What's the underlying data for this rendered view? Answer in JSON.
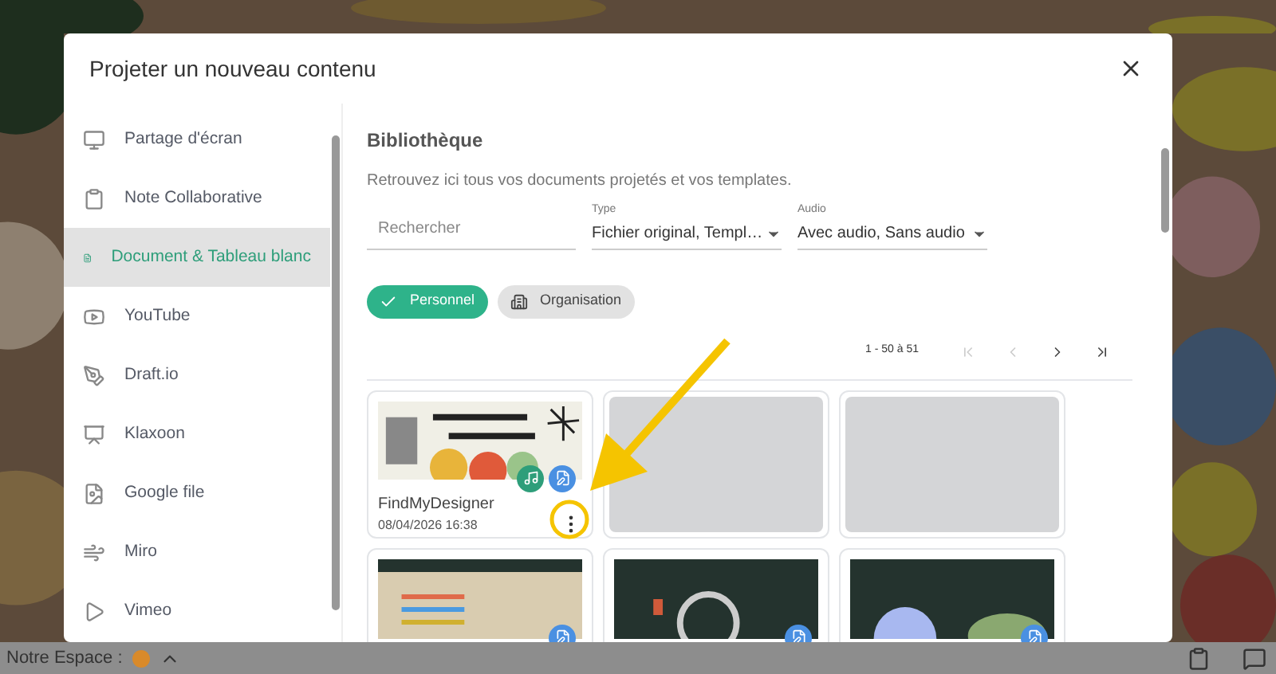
{
  "dialog": {
    "title": "Projeter un nouveau contenu",
    "sidebar": {
      "items": [
        {
          "label": "Partage d'écran",
          "kind": "monitor",
          "selected": false
        },
        {
          "label": "Note Collaborative",
          "kind": "clipboard",
          "selected": false
        },
        {
          "label": "Document & Tableau blanc",
          "kind": "document",
          "selected": true
        },
        {
          "label": "YouTube",
          "kind": "youtube",
          "selected": false
        },
        {
          "label": "Draft.io",
          "kind": "draft",
          "selected": false
        },
        {
          "label": "Klaxoon",
          "kind": "klaxoon",
          "selected": false
        },
        {
          "label": "Google file",
          "kind": "google",
          "selected": false
        },
        {
          "label": "Miro",
          "kind": "miro",
          "selected": false
        },
        {
          "label": "Vimeo",
          "kind": "vimeo",
          "selected": false
        }
      ]
    },
    "library": {
      "title": "Bibliothèque",
      "subtitle": "Retrouvez ici tous vos documents projetés et vos templates.",
      "search": {
        "placeholder": "Rechercher"
      },
      "filters": [
        {
          "label": "Type",
          "value": "Fichier original, Templ…"
        },
        {
          "label": "Audio",
          "value": "Avec audio, Sans audio"
        }
      ],
      "chips": [
        {
          "label": "Personnel",
          "kind": "check",
          "selected": true
        },
        {
          "label": "Organisation",
          "kind": "building",
          "selected": false
        }
      ],
      "pagination": {
        "range": "1 - 50 à 51",
        "buttons": [
          {
            "kind": "first",
            "disabled": true
          },
          {
            "kind": "prev",
            "disabled": true
          },
          {
            "kind": "next",
            "disabled": false
          },
          {
            "kind": "last",
            "disabled": false
          }
        ]
      },
      "cards": [
        {
          "name": "FindMyDesigner",
          "date": "08/04/2026 16:38",
          "audio": true,
          "disabled": false
        },
        {
          "disabled": true
        },
        {
          "disabled": true
        },
        {
          "audio": false,
          "disabled": false
        },
        {
          "audio": false,
          "disabled": false
        },
        {
          "audio": false,
          "disabled": false
        }
      ]
    }
  },
  "bottom_bar": {
    "space_label": "Notre Espace :"
  }
}
